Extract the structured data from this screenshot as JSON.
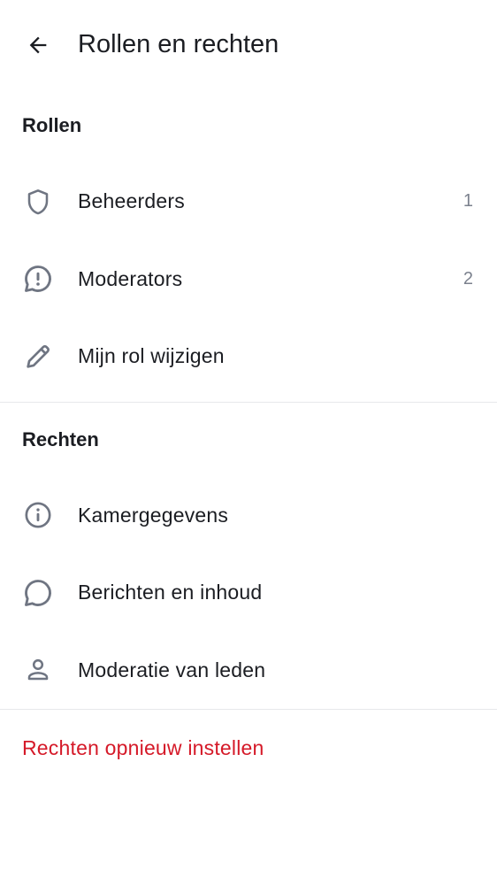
{
  "header": {
    "title": "Rollen en rechten"
  },
  "roles_section": {
    "title": "Rollen",
    "items": [
      {
        "label": "Beheerders",
        "count": "1",
        "icon": "shield-icon"
      },
      {
        "label": "Moderators",
        "count": "2",
        "icon": "alert-bubble-icon"
      },
      {
        "label": "Mijn rol wijzigen",
        "count": "",
        "icon": "pencil-icon"
      }
    ]
  },
  "permissions_section": {
    "title": "Rechten",
    "items": [
      {
        "label": "Kamergegevens",
        "icon": "info-icon"
      },
      {
        "label": "Berichten en inhoud",
        "icon": "chat-bubble-icon"
      },
      {
        "label": "Moderatie van leden",
        "icon": "user-icon"
      }
    ]
  },
  "reset": {
    "label": "Rechten opnieuw instellen",
    "color": "#d51928"
  },
  "colors": {
    "icon": "#6f7582",
    "text": "#1b1d22",
    "secondary": "#7b818d",
    "divider": "#e7e8eb"
  }
}
